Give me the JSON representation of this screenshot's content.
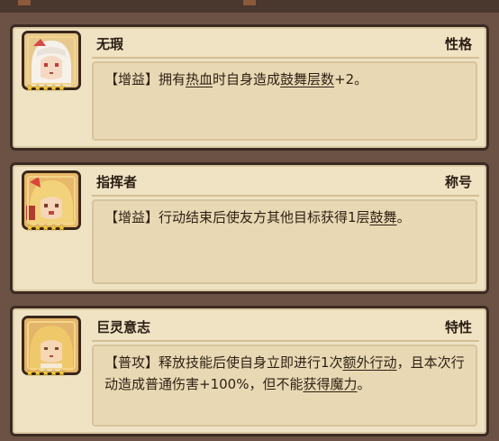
{
  "cards": [
    {
      "name": "无瑕",
      "tag": "性格",
      "stars": "★★★★★",
      "portrait_icon": "white-haired-girl-portrait",
      "desc": {
        "p1": "【增益】拥有",
        "k1": "热血",
        "p2": "时自身造成",
        "k2": "鼓舞层数",
        "p3": "+2。"
      }
    },
    {
      "name": "指挥者",
      "tag": "称号",
      "stars": "★★★★★",
      "portrait_icon": "blonde-girl-portrait",
      "desc": {
        "p1": "【增益】行动结束后使友方其他目标获得1层",
        "k1": "鼓舞",
        "p2": "。"
      }
    },
    {
      "name": "巨灵意志",
      "tag": "特性",
      "stars": "★★★★★",
      "portrait_icon": "golden-haired-girl-portrait",
      "desc": {
        "p1": "【普攻】释放技能后使自身立即进行1次",
        "k1": "额外行动",
        "p2": "，且本次行动造成普通伤害+100%，但不能",
        "k2": "获得魔力",
        "p3": "。"
      }
    }
  ],
  "colors": {
    "card_bg": "#efe3c4",
    "frame": "#3b2a22",
    "background": "#6b5244",
    "star": "#f3c93a"
  }
}
